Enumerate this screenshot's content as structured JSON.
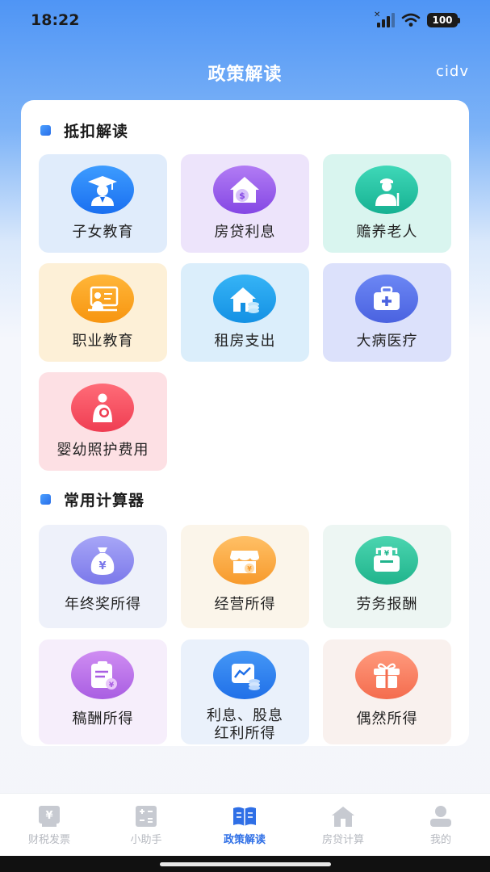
{
  "status_bar": {
    "time": "18:22",
    "battery": "100"
  },
  "header": {
    "title": "政策解读",
    "right_text": "cidv"
  },
  "sections": [
    {
      "title": "抵扣解读",
      "items": [
        {
          "label": "子女教育",
          "icon": "graduate-icon"
        },
        {
          "label": "房贷利息",
          "icon": "house-money-icon"
        },
        {
          "label": "赡养老人",
          "icon": "elderly-icon"
        },
        {
          "label": "职业教育",
          "icon": "teacher-board-icon"
        },
        {
          "label": "租房支出",
          "icon": "house-coins-icon"
        },
        {
          "label": "大病医疗",
          "icon": "medical-kit-icon"
        },
        {
          "label": "婴幼照护费用",
          "icon": "mother-baby-icon"
        }
      ]
    },
    {
      "title": "常用计算器",
      "items": [
        {
          "label": "年终奖所得",
          "icon": "money-bag-icon"
        },
        {
          "label": "经营所得",
          "icon": "shop-icon"
        },
        {
          "label": "劳务报酬",
          "icon": "wallet-icon"
        },
        {
          "label": "稿酬所得",
          "icon": "clipboard-money-icon"
        },
        {
          "label": "利息、股息红利所得",
          "line1": "利息、股息",
          "line2": "红利所得",
          "icon": "stock-chart-icon"
        },
        {
          "label": "偶然所得",
          "icon": "gift-icon"
        }
      ]
    }
  ],
  "bottom_nav": [
    {
      "label": "财税发票",
      "icon": "invoice-icon",
      "active": false
    },
    {
      "label": "小助手",
      "icon": "calculator-icon",
      "active": false
    },
    {
      "label": "政策解读",
      "icon": "book-icon",
      "active": true
    },
    {
      "label": "房贷计算",
      "icon": "house-icon",
      "active": false
    },
    {
      "label": "我的",
      "icon": "user-icon",
      "active": false
    }
  ],
  "colors": {
    "accent": "#2f6fe6",
    "header_blue": "#4f95f5"
  }
}
